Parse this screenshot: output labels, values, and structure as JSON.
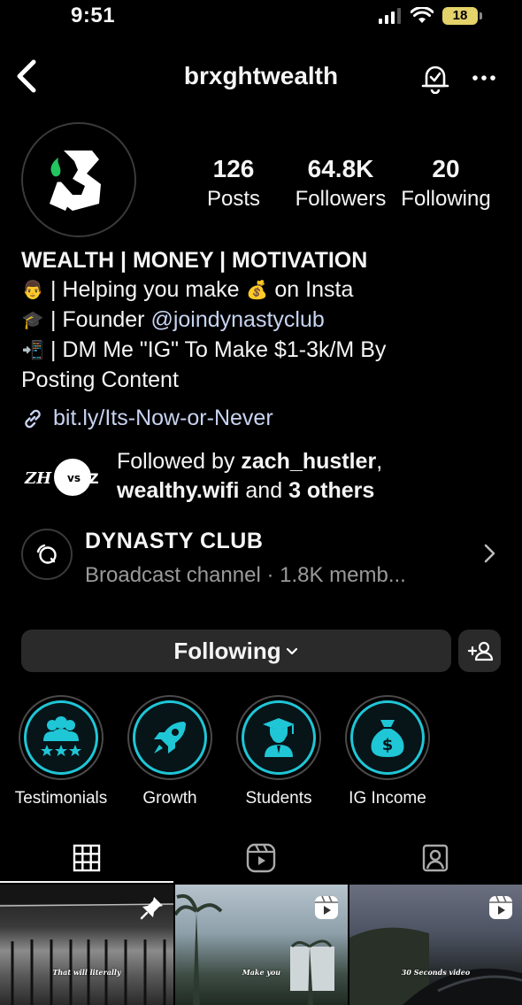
{
  "status_bar": {
    "time": "9:51",
    "battery": "18"
  },
  "header": {
    "username": "brxghtwealth"
  },
  "stats": [
    {
      "value": "126",
      "label": "Posts"
    },
    {
      "value": "64.8K",
      "label": "Followers"
    },
    {
      "value": "20",
      "label": "Following"
    }
  ],
  "bio": {
    "title": "WEALTH | MONEY | MOTIVATION",
    "line1_pre": " | Helping you make ",
    "line1_post": " on Insta",
    "line2_pre": " | Founder ",
    "line2_mention": "@joindynastyclub",
    "line3": " | DM Me \"IG\" To Make $1-3k/M By",
    "line4": "Posting Content"
  },
  "link": "bit.ly/Its-Now-or-Never",
  "followed_by": {
    "prefix": "Followed by ",
    "user1": "zach_hustler",
    "comma": ",",
    "user2": "wealthy.wifi",
    "and": " and ",
    "others": "3 others"
  },
  "channel": {
    "name": "DYNASTY CLUB",
    "subtitle": "Broadcast channel · 1.8K memb..."
  },
  "buttons": {
    "following": "Following"
  },
  "highlights": [
    {
      "label": "Testimonials",
      "icon": "users-stars-icon"
    },
    {
      "label": "Growth",
      "icon": "rocket-icon"
    },
    {
      "label": "Students",
      "icon": "graduate-icon"
    },
    {
      "label": "IG Income",
      "icon": "money-bag-icon"
    }
  ],
  "tabs": [
    {
      "icon": "grid-icon",
      "selected": true
    },
    {
      "icon": "reels-icon",
      "selected": false
    },
    {
      "icon": "tagged-icon",
      "selected": false
    }
  ],
  "posts": [
    {
      "caption": "That will literally",
      "badge": "pin-icon"
    },
    {
      "caption": "Make you",
      "badge": "reel-icon"
    },
    {
      "caption": "30 Seconds video",
      "badge": "reel-icon"
    }
  ],
  "colors": {
    "accent": "#1fc6d6",
    "link": "#c7d3f0",
    "button_bg": "#2a2a2a"
  }
}
